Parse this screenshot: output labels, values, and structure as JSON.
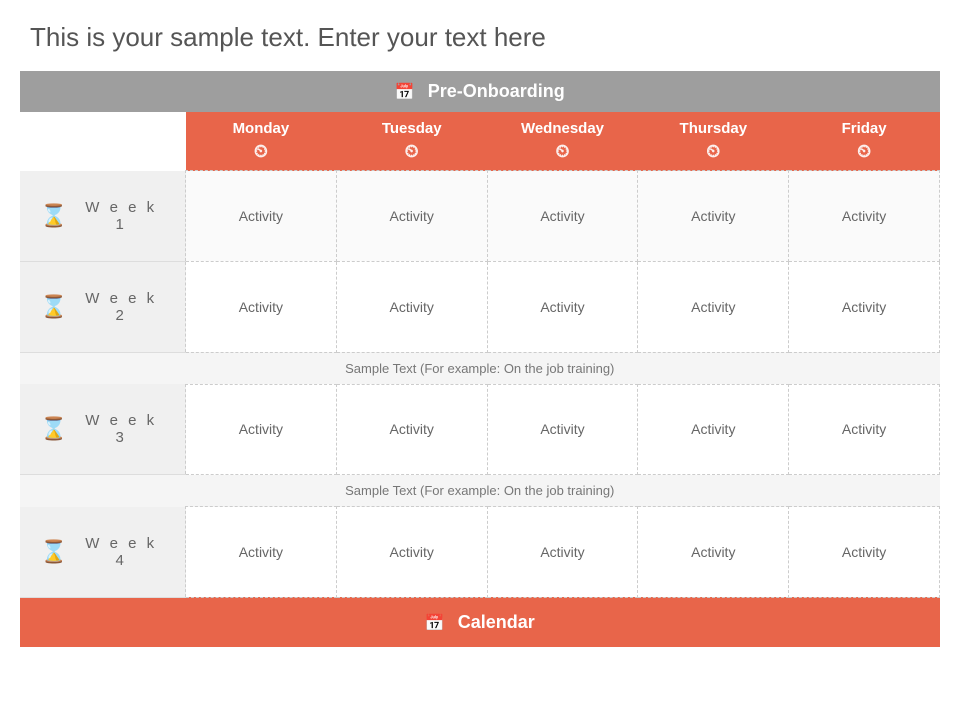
{
  "page": {
    "title": "This is your sample text. Enter your text here",
    "preonboarding_label": "Pre-Onboarding",
    "calendar_label": "Calendar",
    "days": [
      {
        "name": "Monday"
      },
      {
        "name": "Tuesday"
      },
      {
        "name": "Wednesday"
      },
      {
        "name": "Thursday"
      },
      {
        "name": "Friday"
      }
    ],
    "weeks": [
      {
        "label": "W e e k  1",
        "activities": [
          "Activity",
          "Activity",
          "Activity",
          "Activity",
          "Activity"
        ]
      },
      {
        "label": "W e e k  2",
        "activities": [
          "Activity",
          "Activity",
          "Activity",
          "Activity",
          "Activity"
        ],
        "sample_text": "Sample Text (For example: On the job training)"
      },
      {
        "label": "W e e k  3",
        "activities": [
          "Activity",
          "Activity",
          "Activity",
          "Activity",
          "Activity"
        ],
        "sample_text": "Sample Text (For example: On the job training)"
      },
      {
        "label": "W e e k  4",
        "activities": [
          "Activity",
          "Activity",
          "Activity",
          "Activity",
          "Activity"
        ]
      }
    ],
    "colors": {
      "header_bg": "#9e9e9e",
      "accent": "#e8654a",
      "text_dark": "#555555",
      "text_light": "#777777"
    }
  }
}
